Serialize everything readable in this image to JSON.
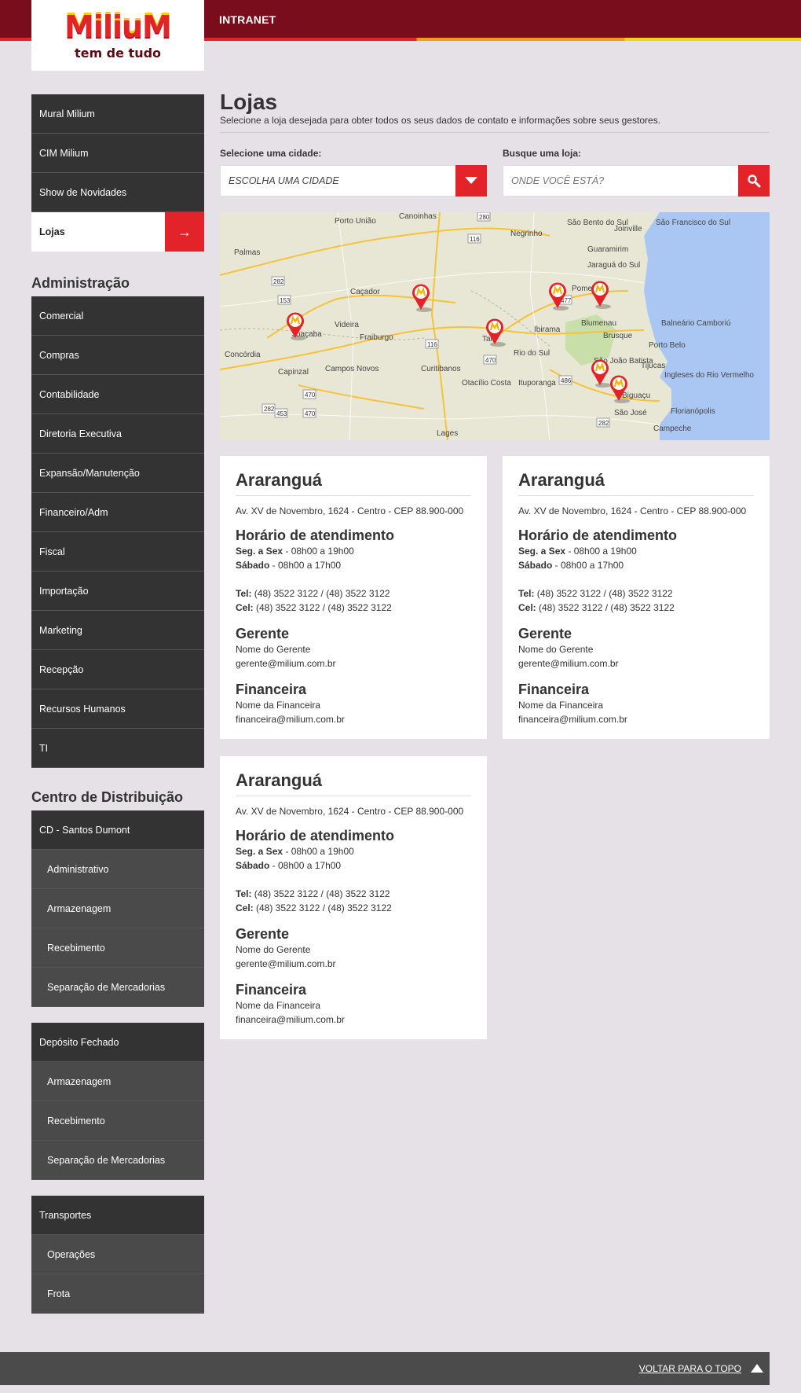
{
  "header": {
    "app_label": "INTRANET",
    "logo_text": "MiliuM",
    "logo_tagline": "tem de tudo"
  },
  "sidebar": {
    "top_items": [
      {
        "label": "Mural Milium"
      },
      {
        "label": "CIM Milium"
      },
      {
        "label": "Show de Novidades"
      },
      {
        "label": "Lojas",
        "active": true
      }
    ],
    "admin_heading": "Administração",
    "admin_items": [
      "Comercial",
      "Compras",
      "Contabilidade",
      "Diretoria Executiva",
      "Expansão/Manutenção",
      "Financeiro/Adm",
      "Fiscal",
      "Importação",
      "Marketing",
      "Recepção",
      "Recursos Humanos",
      "TI"
    ],
    "cd_heading": "Centro de Distribuição",
    "cd_groups": [
      {
        "label": "CD - Santos Dumont",
        "subs": [
          "Administrativo",
          "Armazenagem",
          "Recebimento",
          "Separação de Mercadorias"
        ]
      },
      {
        "label": "Depósito Fechado",
        "subs": [
          "Armazenagem",
          "Recebimento",
          "Separação de Mercadorias"
        ]
      },
      {
        "label": "Transportes",
        "subs": [
          "Operações",
          "Frota"
        ]
      }
    ]
  },
  "main": {
    "title": "Lojas",
    "description": "Selecione a loja desejada para obter todos os seus dados de contato e informações sobre seus gestores.",
    "city_select": {
      "label": "Selecione uma cidade:",
      "value": "ESCOLHA UMA CIDADE"
    },
    "store_search": {
      "label": "Busque uma loja:",
      "placeholder": "ONDE VOCÊ ESTÁ?"
    }
  },
  "map": {
    "labels": [
      "Porto União",
      "Canoinhas",
      "São Bento do Sul",
      "São Francisco do Sul",
      "Negrinho",
      "Joinville",
      "Guaramirim",
      "Jaraguá do Sul",
      "Palmas",
      "Caçador",
      "Pomerode",
      "Videira",
      "Balneário Camboriú",
      "Blumenau",
      "Fraiburgo",
      "Brusque",
      "Porto Belo",
      "Concórdia",
      "Joaçaba",
      "Taió",
      "Ibirama",
      "Rio do Sul",
      "São João Batista",
      "Tijucas",
      "Capinzal",
      "Campos Novos",
      "Curitibanos",
      "Otacílio Costa",
      "Ituporanga",
      "Biguaçu",
      "Ingleses do Rio Vermelho",
      "Florianópolis",
      "São José",
      "Campeche",
      "Lages"
    ],
    "road_numbers": [
      "280",
      "116",
      "282",
      "153",
      "477",
      "470",
      "486",
      "116",
      "470",
      "282",
      "453",
      "470",
      "282"
    ]
  },
  "stores": [
    {
      "city": "Araranguá",
      "address": "Av. XV de Novembro, 1624 - Centro - CEP 88.900-000",
      "hours_title": "Horário de atendimento",
      "hours_weekday_label": "Seg. a Sex",
      "hours_weekday": " - 08h00 a 19h00",
      "hours_saturday_label": "Sábado",
      "hours_saturday": " - 08h00 a 17h00",
      "tel_label": "Tel:",
      "tel": " (48) 3522 3122 / (48) 3522 3122",
      "cel_label": "Cel:",
      "cel": " (48) 3522 3122 / (48) 3522 3122",
      "manager_title": "Gerente",
      "manager_name": "Nome do Gerente",
      "manager_email": "gerente@milium.com.br",
      "finance_title": "Financeira",
      "finance_name": "Nome da Financeira",
      "finance_email": "financeira@milium.com.br"
    },
    {
      "city": "Araranguá",
      "address": "Av. XV de Novembro, 1624 - Centro - CEP 88.900-000",
      "hours_title": "Horário de atendimento",
      "hours_weekday_label": "Seg. a Sex",
      "hours_weekday": " - 08h00 a 19h00",
      "hours_saturday_label": "Sábado",
      "hours_saturday": " - 08h00 a 17h00",
      "tel_label": "Tel:",
      "tel": " (48) 3522 3122 / (48) 3522 3122",
      "cel_label": "Cel:",
      "cel": " (48) 3522 3122 / (48) 3522 3122",
      "manager_title": "Gerente",
      "manager_name": "Nome do Gerente",
      "manager_email": "gerente@milium.com.br",
      "finance_title": "Financeira",
      "finance_name": "Nome da Financeira",
      "finance_email": "financeira@milium.com.br"
    },
    {
      "city": "Araranguá",
      "address": "Av. XV de Novembro, 1624 - Centro - CEP 88.900-000",
      "hours_title": "Horário de atendimento",
      "hours_weekday_label": "Seg. a Sex",
      "hours_weekday": " - 08h00 a 19h00",
      "hours_saturday_label": "Sábado",
      "hours_saturday": " - 08h00 a 17h00",
      "tel_label": "Tel:",
      "tel": " (48) 3522 3122 / (48) 3522 3122",
      "cel_label": "Cel:",
      "cel": " (48) 3522 3122 / (48) 3522 3122",
      "manager_title": "Gerente",
      "manager_name": "Nome do Gerente",
      "manager_email": "gerente@milium.com.br",
      "finance_title": "Financeira",
      "finance_name": "Nome da Financeira",
      "finance_email": "financeira@milium.com.br"
    }
  ],
  "footer": {
    "back_to_top": "VOLTAR PARA O TOPO"
  },
  "colors": {
    "brand_red": "#e2232a",
    "header_bg": "#7a0d1c",
    "nav_dark": "#333333",
    "nav_sub": "#4a4a4a",
    "page_bg": "#e6e1e7"
  }
}
